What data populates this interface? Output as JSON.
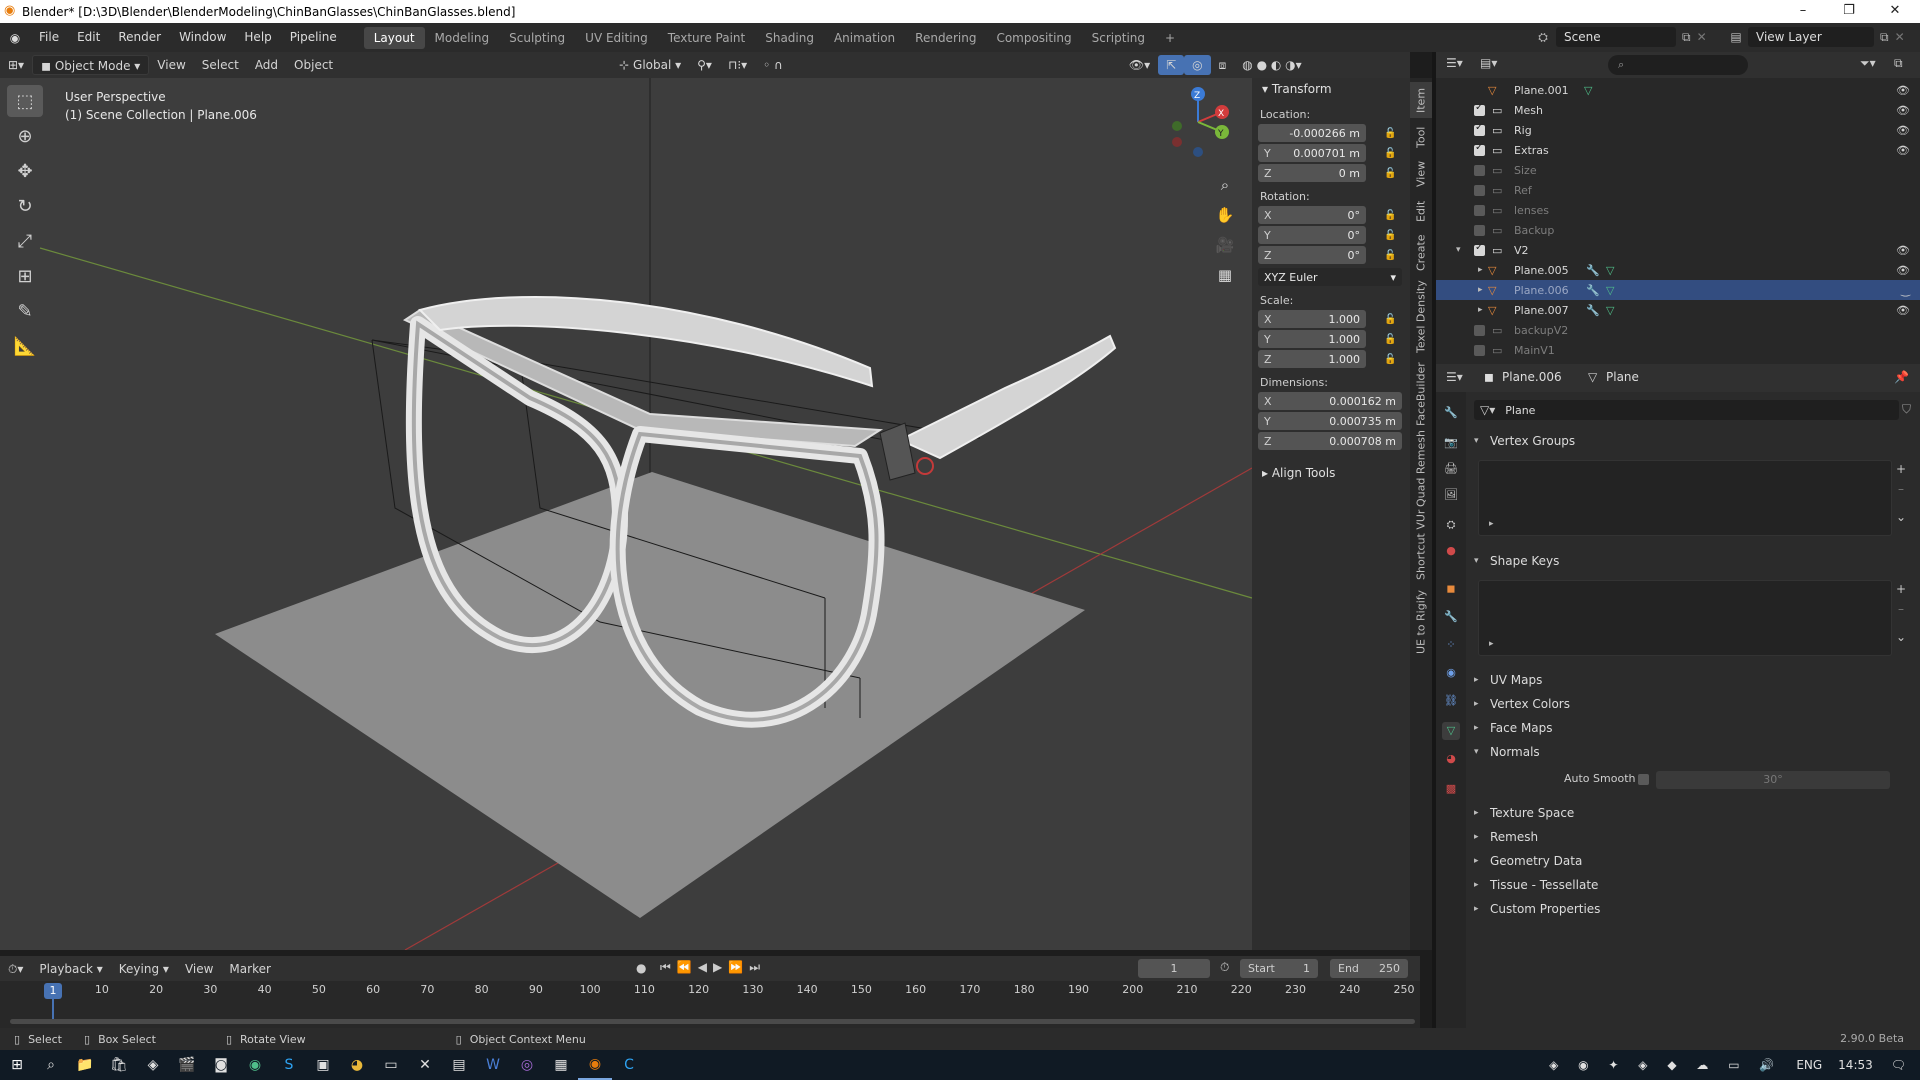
{
  "window": {
    "title": "Blender* [D:\\3D\\Blender\\BlenderModeling\\ChinBanGlasses\\ChinBanGlasses.blend]"
  },
  "menus": [
    "File",
    "Edit",
    "Render",
    "Window",
    "Help",
    "Pipeline"
  ],
  "workspaces": [
    "Layout",
    "Modeling",
    "Sculpting",
    "UV Editing",
    "Texture Paint",
    "Shading",
    "Animation",
    "Rendering",
    "Compositing",
    "Scripting"
  ],
  "scene": {
    "label": "Scene",
    "view_layer": "View Layer"
  },
  "header3d": {
    "mode": "Object Mode",
    "view": "View",
    "select": "Select",
    "add": "Add",
    "object": "Object",
    "orientation": "Global"
  },
  "viewport": {
    "perspective": "User Perspective",
    "collection": "(1) Scene Collection | Plane.006",
    "gizmo": {
      "x": "X",
      "y": "Y",
      "z": "Z"
    }
  },
  "npanel": {
    "transform": "Transform",
    "location_label": "Location:",
    "location": [
      "-0.000266 m",
      "0.000701 m",
      "0 m"
    ],
    "rotation_label": "Rotation:",
    "rotation": [
      "0°",
      "0°",
      "0°"
    ],
    "rotation_mode": "XYZ Euler",
    "scale_label": "Scale:",
    "scale": [
      "1.000",
      "1.000",
      "1.000"
    ],
    "dimensions_label": "Dimensions:",
    "dimensions": [
      "0.000162 m",
      "0.000735 m",
      "0.000708 m"
    ],
    "align_tools": "Align Tools",
    "axes": [
      "X",
      "Y",
      "Z"
    ]
  },
  "ntabs": [
    "Item",
    "Tool",
    "View",
    "Edit",
    "Create",
    "Texel Density",
    "FaceBuilder",
    "Quad Remesh",
    "Shortcut VUr",
    "UE to Rigify"
  ],
  "outliner": {
    "rows": [
      {
        "name": "Plane.001"
      },
      {
        "name": "Mesh"
      },
      {
        "name": "Rig"
      },
      {
        "name": "Extras"
      },
      {
        "name": "Size"
      },
      {
        "name": "Ref"
      },
      {
        "name": "lenses"
      },
      {
        "name": "Backup"
      },
      {
        "name": "V2"
      },
      {
        "name": "Plane.005"
      },
      {
        "name": "Plane.006"
      },
      {
        "name": "Plane.007"
      },
      {
        "name": "backupV2"
      },
      {
        "name": "MainV1"
      }
    ]
  },
  "properties": {
    "object": "Plane.006",
    "data": "Plane",
    "mesh_name": "Plane",
    "sections": [
      "Vertex Groups",
      "Shape Keys",
      "UV Maps",
      "Vertex Colors",
      "Face Maps",
      "Normals",
      "Texture Space",
      "Remesh",
      "Geometry Data",
      "Tissue - Tessellate",
      "Custom Properties"
    ],
    "auto_smooth": "Auto Smooth",
    "angle": "30°"
  },
  "timeline": {
    "playback": "Playback",
    "keying": "Keying",
    "view": "View",
    "marker": "Marker",
    "frame": "1",
    "start_label": "Start",
    "start": "1",
    "end_label": "End",
    "end": "250",
    "ticks": [
      "1",
      "10",
      "20",
      "30",
      "40",
      "50",
      "60",
      "70",
      "80",
      "90",
      "100",
      "110",
      "120",
      "130",
      "140",
      "150",
      "160",
      "170",
      "180",
      "190",
      "200",
      "210",
      "220",
      "230",
      "240",
      "250"
    ]
  },
  "status": {
    "select": "Select",
    "box_select": "Box Select",
    "rotate_view": "Rotate View",
    "context_menu": "Object Context Menu",
    "version": "2.90.0 Beta"
  },
  "taskbar": {
    "lang": "ENG",
    "time": "14:53"
  }
}
